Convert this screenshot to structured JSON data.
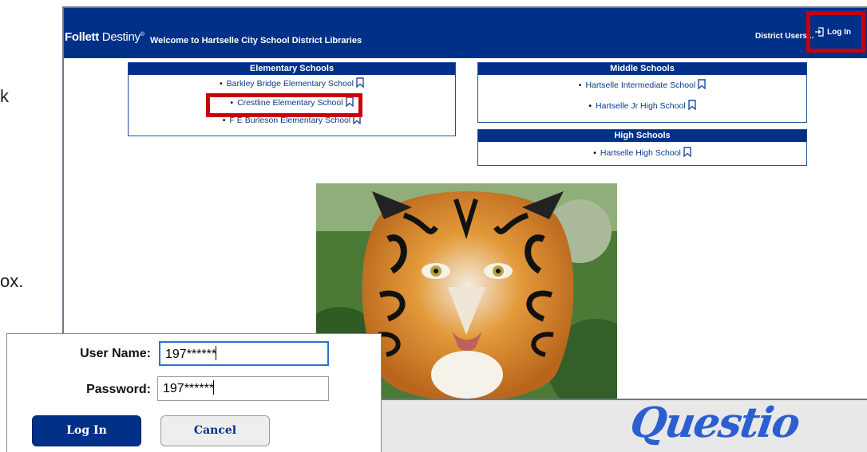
{
  "fragments": {
    "a": "k",
    "b": "ox."
  },
  "header": {
    "brand_bold": "Follett",
    "brand_light": "Destiny",
    "brand_mark": "®",
    "welcome": "Welcome to Hartselle City School District Libraries",
    "district_users": "District Users ..",
    "login": "Log In"
  },
  "elementary": {
    "title": "Elementary Schools",
    "items": [
      "Barkley Bridge Elementary School",
      "Crestline Elementary School",
      "F E Burleson Elementary School"
    ]
  },
  "middle": {
    "title": "Middle Schools",
    "items": [
      "Hartselle Intermediate School",
      "Hartselle Jr High School"
    ]
  },
  "high": {
    "title": "High Schools",
    "items": [
      "Hartselle High School"
    ]
  },
  "login_panel": {
    "username_label": "User Name:",
    "username_value": "197******",
    "password_label": "Password:",
    "password_value": "197******",
    "login_button": "Log In",
    "cancel_button": "Cancel"
  },
  "graphic_text": "Questio",
  "colors": {
    "header": "#003087",
    "highlight": "#c8000b",
    "link": "#0a3a8a"
  }
}
